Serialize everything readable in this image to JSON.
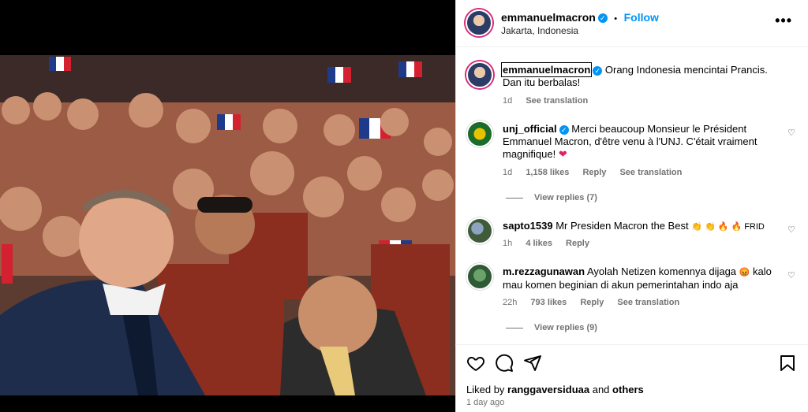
{
  "post": {
    "username": "emmanuelmacron",
    "follow_label": "Follow",
    "separator": "•",
    "location": "Jakarta, Indonesia",
    "more_glyph": "•••",
    "caption_line1": "Orang Indonesia mencintai Prancis.",
    "caption_line2": "Dan itu berbalas!",
    "caption_time": "1d",
    "see_translation": "See translation"
  },
  "comments": [
    {
      "username": "unj_official",
      "text_line1": "Merci beaucoup Monsieur le Président",
      "text_line2": "Emmanuel Macron, d'être venu à l'UNJ. C'était vraiment",
      "text_line3": "magnifique!",
      "emoji": "❤",
      "time": "1d",
      "likes": "1,158 likes",
      "reply": "Reply",
      "translate": "See translation",
      "view_replies": "View replies (7)"
    },
    {
      "username": "sapto1539",
      "text": "Mr Presiden Macron the Best",
      "emoji": "👏 👏 🔥 🔥 FRID",
      "time": "1h",
      "likes": "4 likes",
      "reply": "Reply"
    },
    {
      "username": "m.rezzagunawan",
      "text_line1": "Ayolah Netizen komennya dijaga",
      "emoji": "😡",
      "text_line1b": "kalo",
      "text_line2": "mau komen beginian di akun pemerintahan indo aja",
      "time": "22h",
      "likes": "793 likes",
      "reply": "Reply",
      "translate": "See translation",
      "view_replies": "View replies (9)"
    }
  ],
  "footer": {
    "liked_prefix": "Liked by",
    "liked_user": "ranggaversiduaa",
    "liked_and": "and",
    "liked_others": "others",
    "posted_ago": "1 day ago"
  },
  "icons": {
    "like": "heart-icon",
    "comment": "comment-icon",
    "share": "share-icon",
    "save": "bookmark-icon",
    "verified": "verified-badge-icon"
  },
  "colors": {
    "link_blue": "#0095f6",
    "verified_blue": "#0095f6",
    "muted": "#737373",
    "border": "#dbdbdb",
    "story_ring": "#d62976"
  }
}
